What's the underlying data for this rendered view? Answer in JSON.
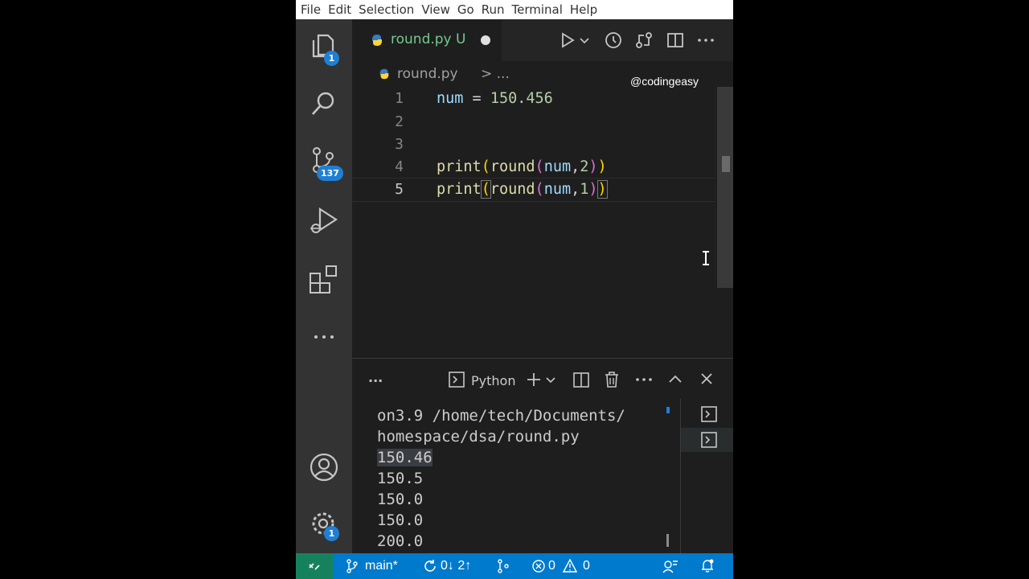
{
  "menu": [
    "File",
    "Edit",
    "Selection",
    "View",
    "Go",
    "Run",
    "Terminal",
    "Help"
  ],
  "activity_bar": {
    "explorer_badge": "1",
    "source_control_badge": "137",
    "settings_badge": "1",
    "icons": [
      "files-icon",
      "search-icon",
      "source-control-icon",
      "run-debug-icon",
      "extensions-icon",
      "more-icon",
      "account-icon",
      "gear-icon"
    ]
  },
  "tab": {
    "filename": "round.py",
    "status": "U",
    "modified": true
  },
  "breadcrumb": {
    "file": "round.py",
    "separator": "> ..."
  },
  "watermark": "@codingeasy",
  "editor": {
    "lines": [
      {
        "number": "1",
        "code": "num = 150.456"
      },
      {
        "number": "2",
        "code": ""
      },
      {
        "number": "3",
        "code": ""
      },
      {
        "number": "4",
        "code": "print(round(num,2))"
      },
      {
        "number": "5",
        "code": "print(round(num,1))"
      }
    ],
    "active_line": 5
  },
  "panel": {
    "more": "...",
    "terminal_name": "Python",
    "output": [
      "on3.9 /home/tech/Documents/",
      "homespace/dsa/round.py",
      "150.46",
      "150.5",
      "150.0",
      "150.0",
      "200.0"
    ],
    "highlighted_line": 2
  },
  "status_bar": {
    "branch": "main*",
    "sync": "0↓ 2↑",
    "errors": "0",
    "warnings": "0"
  },
  "colors": {
    "accent": "#007acc",
    "remote": "#16825d",
    "untracked": "#73c991"
  }
}
